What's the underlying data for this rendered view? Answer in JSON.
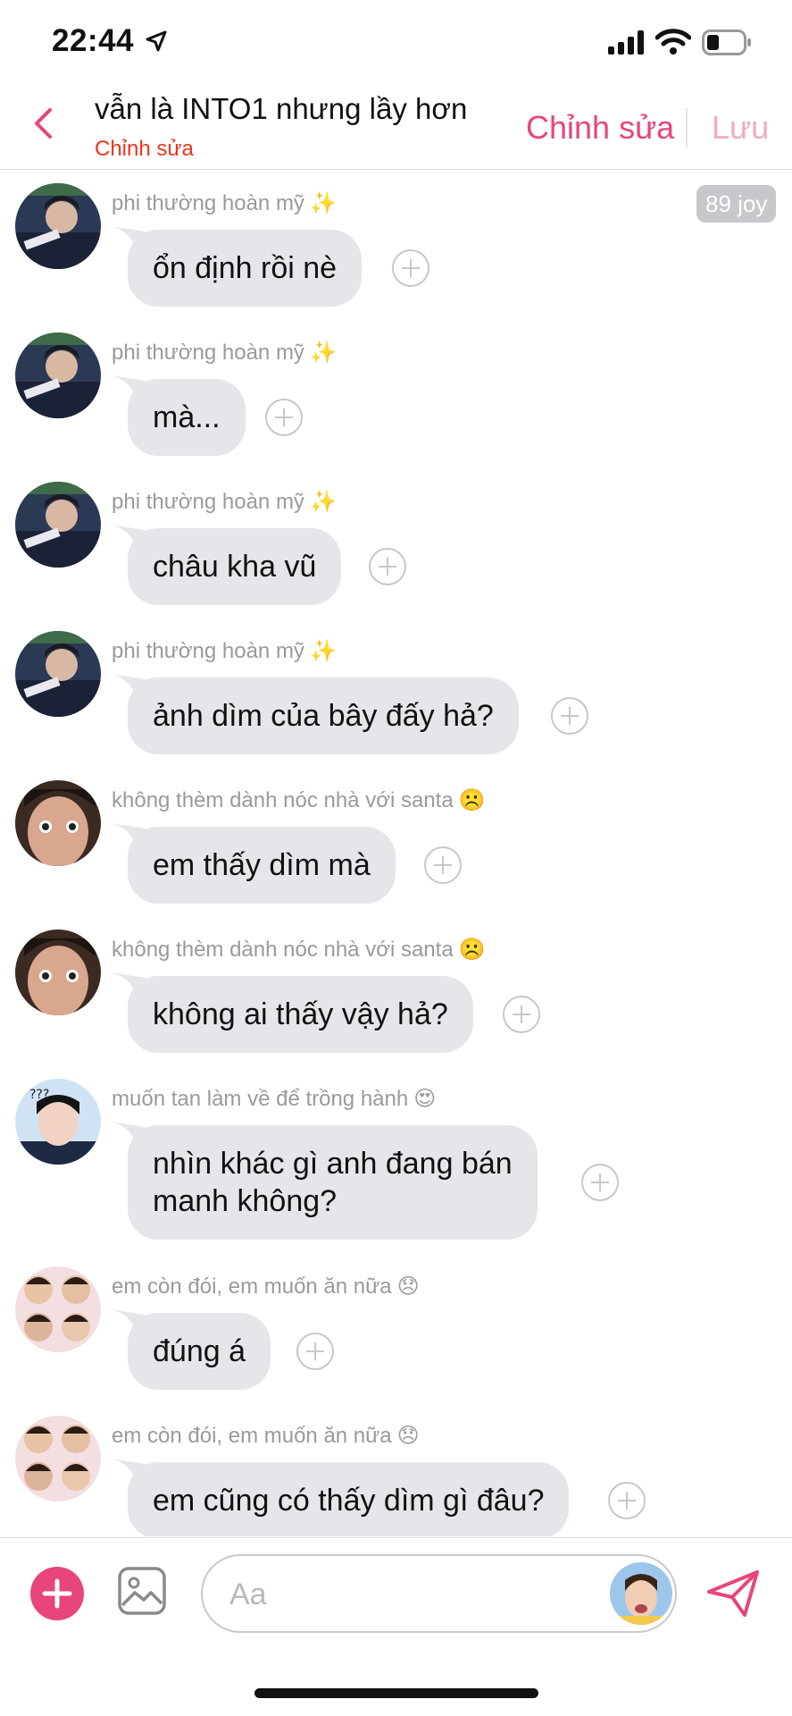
{
  "status_bar": {
    "time": "22:44"
  },
  "header": {
    "title": "vẫn là INTO1 nhưng lầy hơn",
    "subtitle": "Chỉnh sửa",
    "edit_label": "Chỉnh sửa",
    "save_label": "Lưu"
  },
  "chat": {
    "joy_badge": "89 joy",
    "messages": [
      {
        "sender": "phi thường hoàn mỹ",
        "emoji": "✨",
        "text": "ổn định rồi nè"
      },
      {
        "sender": "phi thường hoàn mỹ",
        "emoji": "✨",
        "text": "mà..."
      },
      {
        "sender": "phi thường hoàn mỹ",
        "emoji": "✨",
        "text": "châu kha vũ"
      },
      {
        "sender": "phi thường hoàn mỹ",
        "emoji": "✨",
        "text": "ảnh dìm của bây đấy hả?"
      },
      {
        "sender": "không thèm dành nóc nhà với santa",
        "emoji": "☹️",
        "text": "em thấy dìm mà"
      },
      {
        "sender": "không thèm dành nóc nhà với santa",
        "emoji": "☹️",
        "text": "không ai thấy vậy hả?"
      },
      {
        "sender": "muốn tan làm về để trồng hành",
        "emoji": "😍",
        "text_line1": "nhìn khác gì anh đang bán",
        "text_line2": "manh không?"
      },
      {
        "sender": "em còn đói, em muốn ăn nữa",
        "emoji": "😞",
        "text": "đúng á"
      },
      {
        "sender": "em còn đói, em muốn ăn nữa",
        "emoji": "😞",
        "text": "em cũng có thấy dìm gì đâu?"
      }
    ]
  },
  "composer": {
    "placeholder": "Aa"
  },
  "colors": {
    "accent": "#e8457b",
    "bubble": "#e4e6e9",
    "subtitle": "#e8371c",
    "save_disabled": "#f2a9c1"
  }
}
